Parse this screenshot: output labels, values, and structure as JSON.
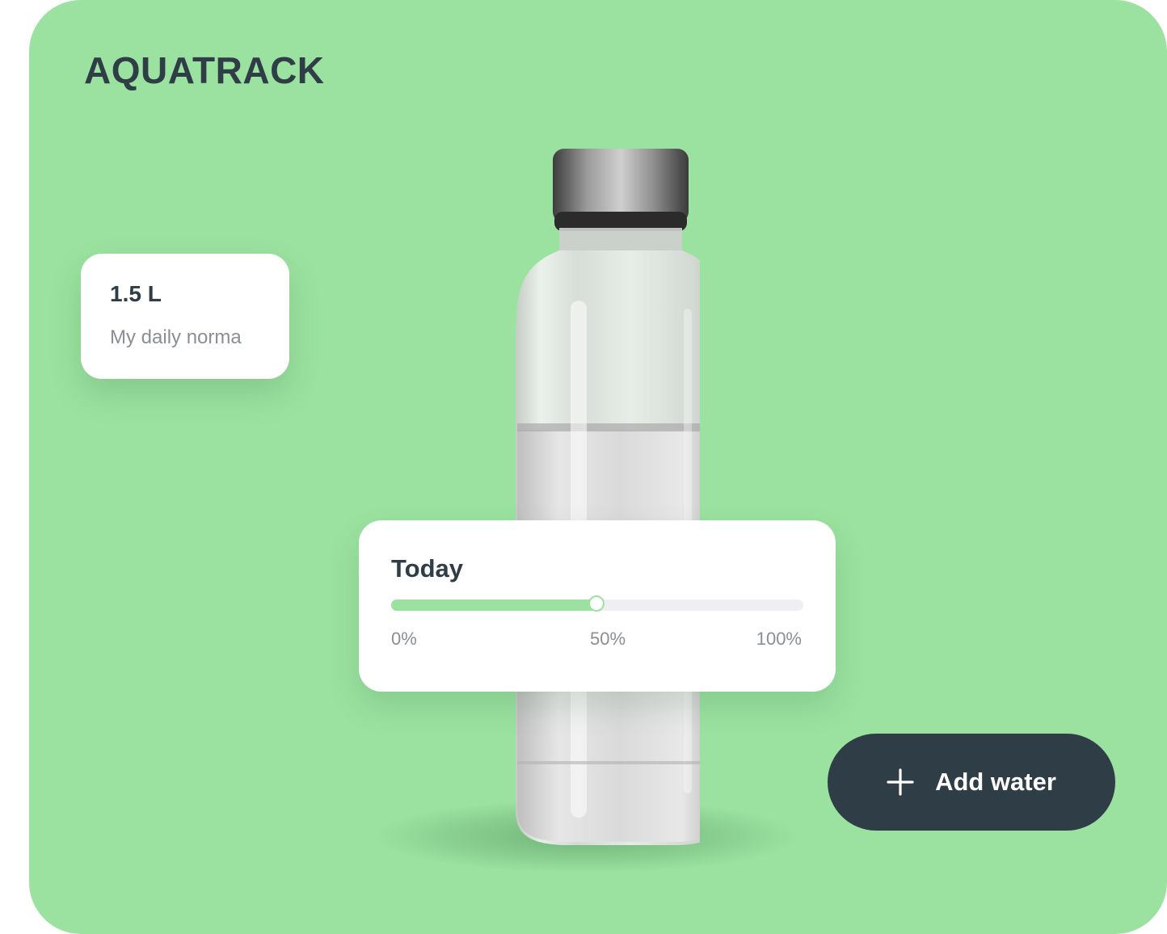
{
  "app": {
    "title": "AQUATRACK"
  },
  "daily_norma": {
    "value": "1.5 L",
    "label": "My daily norma"
  },
  "today": {
    "title": "Today",
    "progress_percent": 50,
    "ticks": [
      "0%",
      "50%",
      "100%"
    ]
  },
  "actions": {
    "add_water_label": "Add water",
    "add_icon": "plus-icon"
  },
  "colors": {
    "accent": "#9be2a0",
    "dark": "#2f3e46",
    "muted": "#8a8f93",
    "track": "#eeeef3"
  }
}
